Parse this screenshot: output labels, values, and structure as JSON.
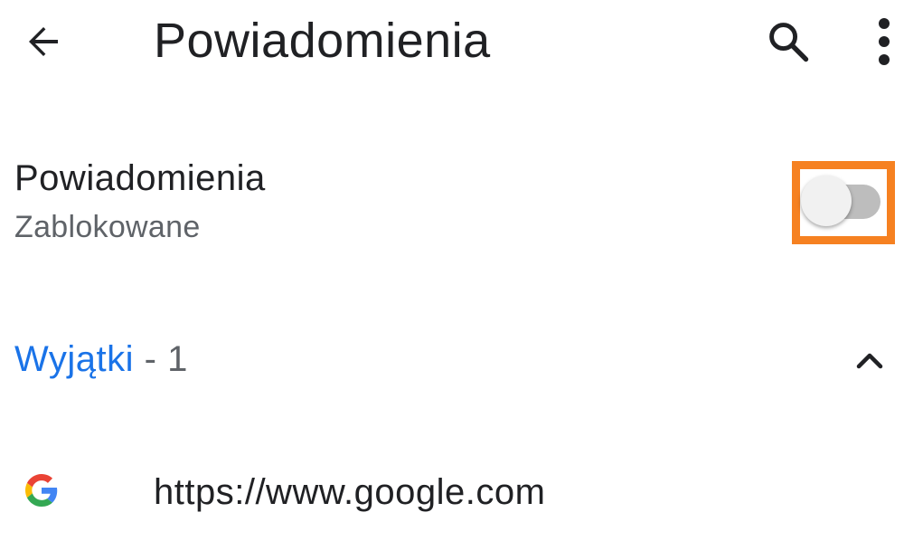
{
  "toolbar": {
    "title": "Powiadomienia",
    "back_icon": "arrow-back-icon",
    "search_icon": "search-icon",
    "menu_icon": "more-vert-icon"
  },
  "notifications": {
    "title": "Powiadomienia",
    "status": "Zablokowane",
    "toggle_on": false,
    "highlight_color": "#f68121"
  },
  "exceptions": {
    "label": "Wyjątki",
    "count": " - 1",
    "expanded": true,
    "collapse_icon": "chevron-up-icon",
    "label_color": "#1a73e8"
  },
  "sites": [
    {
      "url": "https://www.google.com",
      "favicon": "google-g-icon"
    }
  ]
}
